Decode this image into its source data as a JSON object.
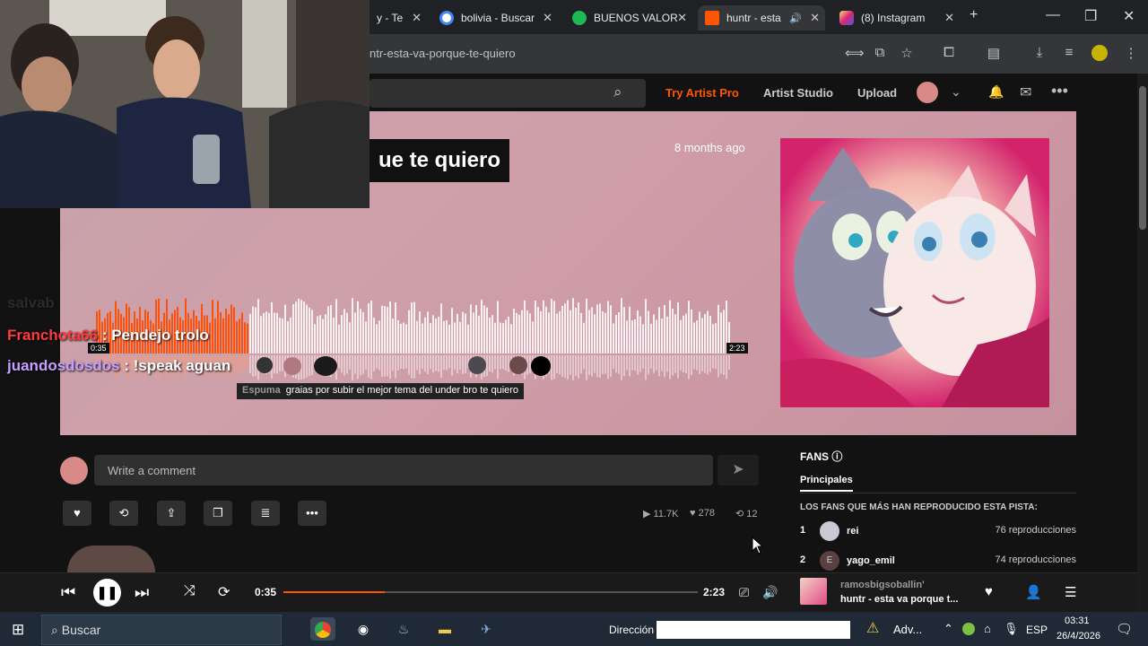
{
  "browser": {
    "tabs": [
      {
        "title": "y - Te",
        "icon": "app-icon",
        "color": "#888888"
      },
      {
        "title": "bolivia - Buscar",
        "icon": "google-icon",
        "color": "#4285f4"
      },
      {
        "title": "BUENOS VALOR",
        "icon": "spotify-icon",
        "color": "#1db954"
      },
      {
        "title": "huntr - esta",
        "icon": "soundcloud-icon",
        "color": "#ff5500",
        "active": true
      },
      {
        "title": "(8) Instagram",
        "icon": "instagram-icon",
        "color": "#d6249f"
      }
    ],
    "url": "ntr-esta-va-porque-te-quiero"
  },
  "header": {
    "links": [
      "Try Artist Pro",
      "Artist Studio",
      "Upload"
    ],
    "accent": "#ff5500"
  },
  "track": {
    "title": "ue te quiero",
    "age": "8 months ago",
    "elapsed_badge": "0:35",
    "duration_badge": "2:23",
    "progress": 0.245
  },
  "comment_tooltip": {
    "user": "Espuma",
    "text": "graias por subir el mejor tema del under bro te quiero"
  },
  "chat": {
    "ghost": "salvab",
    "messages": [
      {
        "user": "Franchota66",
        "sep": " : ",
        "text": "Pendejo trolo",
        "user_color": "#ff3b3b"
      },
      {
        "user": "juandosdosdos",
        "sep": " : ",
        "text": "!speak aguan",
        "user_color": "#c6a0ff"
      }
    ]
  },
  "comment": {
    "placeholder": "Write a comment"
  },
  "stats": {
    "plays": "11.7K",
    "likes": "278",
    "reposts": "12"
  },
  "fans": {
    "title": "FANS",
    "tab": "Principales",
    "subtitle": "LOS FANS QUE MÁS HAN REPRODUCIDO ESTA PISTA:",
    "rows": [
      {
        "rank": "1",
        "avatar": "",
        "name": "rei",
        "plays": "76 reproducciones"
      },
      {
        "rank": "2",
        "avatar": "E",
        "name": "yago_emil",
        "plays": "74 reproducciones"
      }
    ]
  },
  "player": {
    "current": "0:35",
    "total": "2:23",
    "progress": 0.245,
    "artist": "ramosbigsoballin'",
    "title": "huntr - esta va porque t..."
  },
  "taskbar": {
    "search": "Buscar",
    "address_label": "Dirección",
    "tray_app": "Adv...",
    "lang": "ESP",
    "time": "03:31",
    "date": "26/4/2026"
  }
}
